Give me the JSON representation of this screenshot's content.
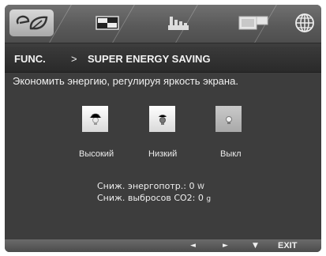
{
  "tabs": [
    {
      "name": "energy-saving-tab",
      "icon": "eco-leaf-icon",
      "active": true
    },
    {
      "name": "picture-tab",
      "icon": "picture-settings-icon",
      "active": false
    },
    {
      "name": "color-tab",
      "icon": "color-bars-icon",
      "active": false
    },
    {
      "name": "display-tab",
      "icon": "display-windows-icon",
      "active": false
    },
    {
      "name": "language-tab",
      "icon": "globe-icon",
      "active": false
    }
  ],
  "header": {
    "section": "FUNC.",
    "separator": ">",
    "title": "SUPER ENERGY SAVING"
  },
  "description": "Экономить энергию, регулируя яркость экрана.",
  "options": [
    {
      "label": "Высокий",
      "icon": "bulb-high-icon"
    },
    {
      "label": "Низкий",
      "icon": "bulb-low-icon"
    },
    {
      "label": "Выкл",
      "icon": "bulb-off-icon"
    }
  ],
  "stats": {
    "power_label": "Сниж. энергопотр.:",
    "power_value": "0",
    "power_unit": "W",
    "co2_label": "Сниж. выбросов CO2:",
    "co2_value": "0",
    "co2_unit": "g"
  },
  "footer": {
    "left_arrow": "◄",
    "right_arrow": "►",
    "down_arrow": "▼",
    "exit_label": "EXIT"
  }
}
